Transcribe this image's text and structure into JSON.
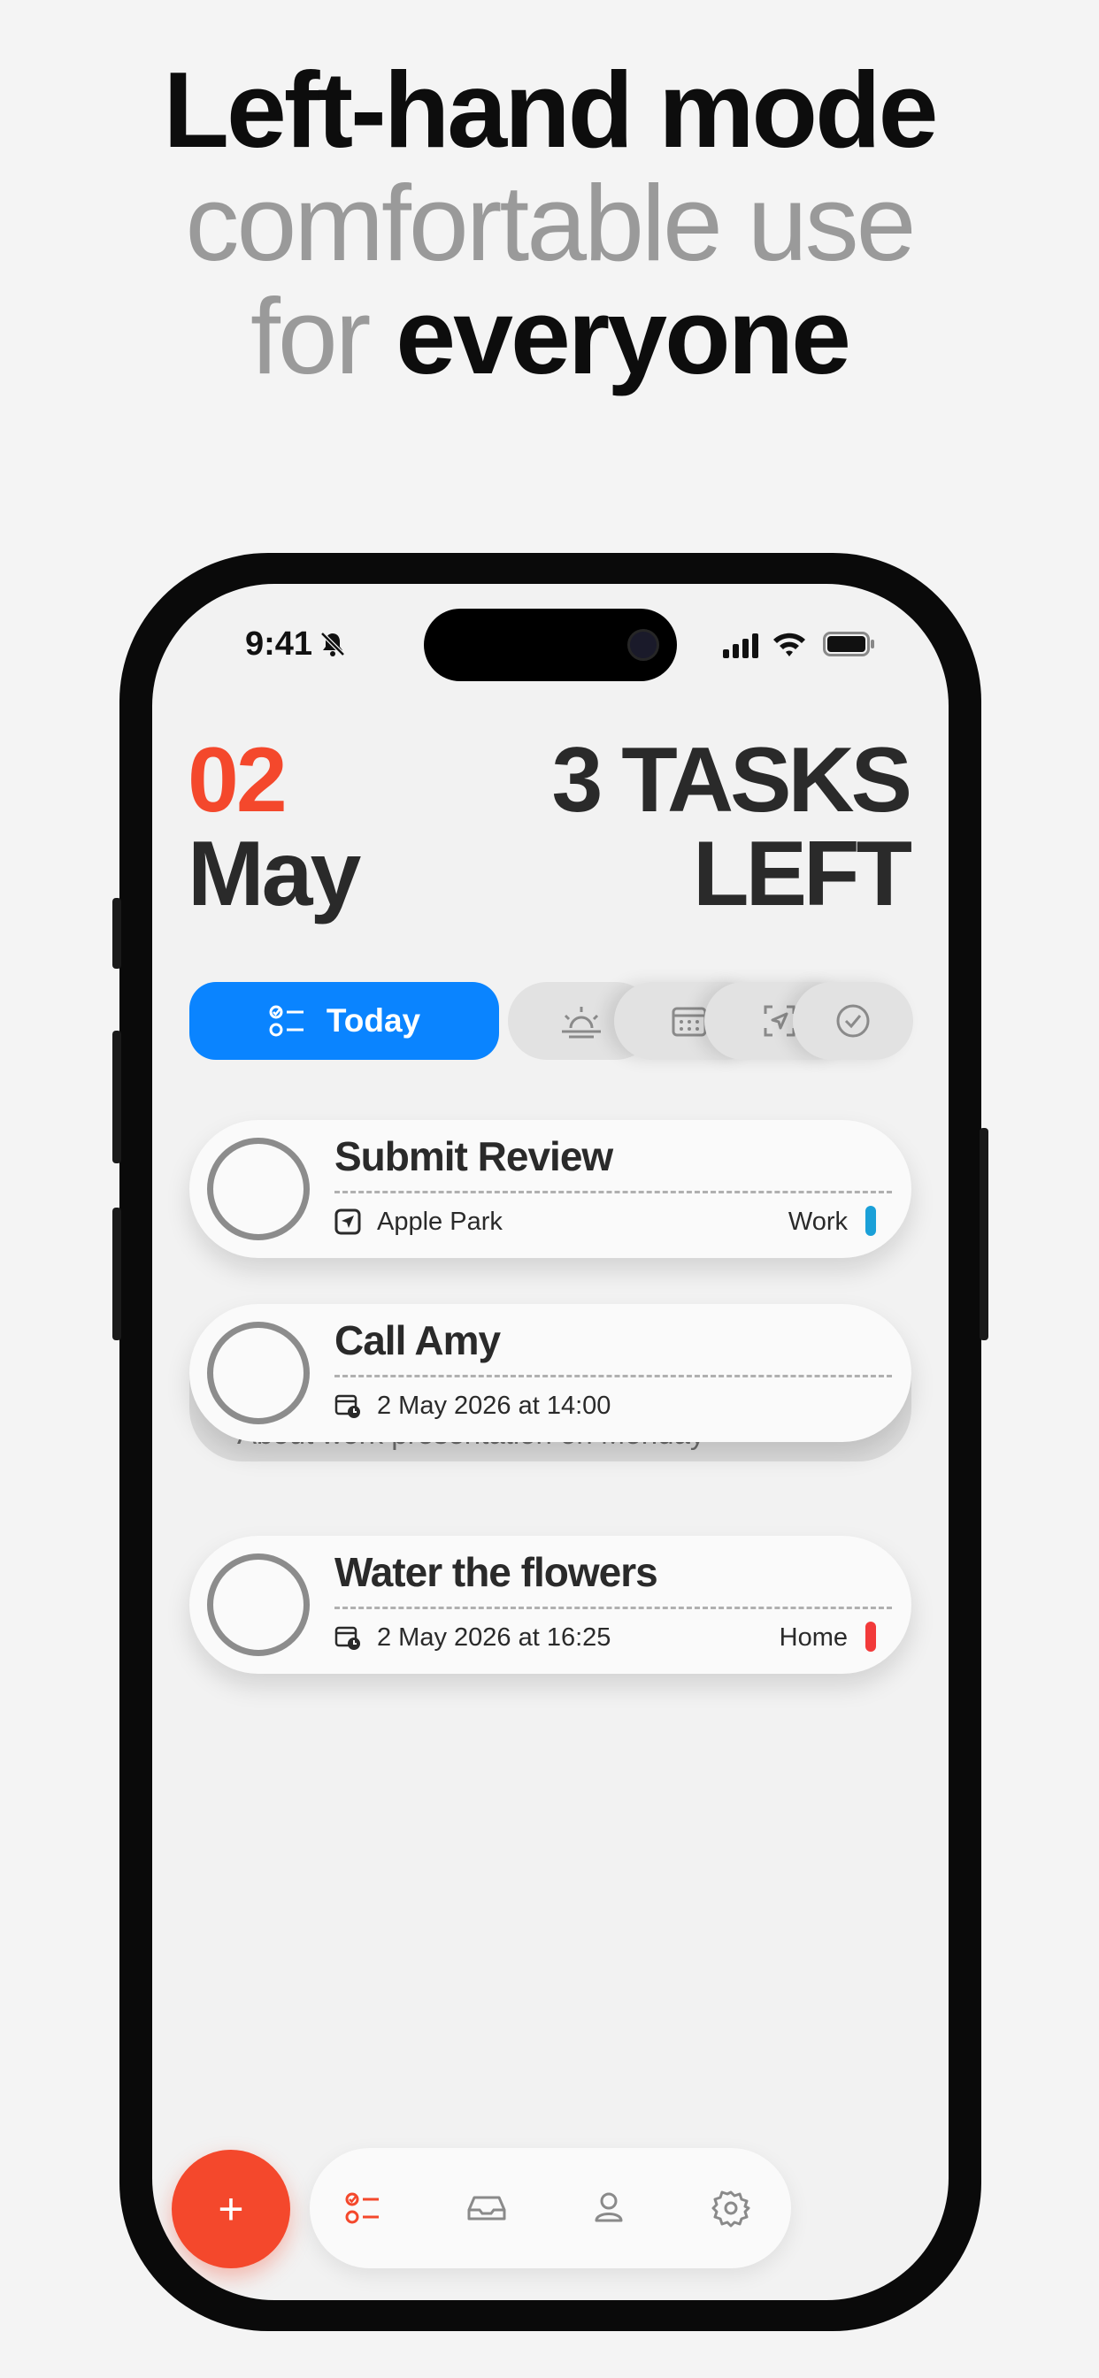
{
  "headline": {
    "line1": "Left-hand mode",
    "line2": "comfortable use",
    "line3_grey": "for",
    "line3_dark": "everyone"
  },
  "status_bar": {
    "time": "9:41"
  },
  "header": {
    "day": "02",
    "month": "May",
    "tasks_line1": "3 TASKS",
    "tasks_line2": "LEFT"
  },
  "filters": {
    "active_label": "Today",
    "icons": [
      "sunrise-icon",
      "calendar-icon",
      "location-icon",
      "check-circle-icon"
    ]
  },
  "tasks": [
    {
      "title": "Submit Review",
      "meta": "Apple Park",
      "meta_icon": "location-arrow-icon",
      "tag": "Work",
      "tag_color": "#1aa0d8"
    },
    {
      "title": "Call Amy",
      "meta": "2 May 2026 at 14:00",
      "meta_icon": "calendar-clock-icon",
      "note": "About work presentation on Monday"
    },
    {
      "title": "Water the flowers",
      "meta": "2 May 2026 at 16:25",
      "meta_icon": "calendar-clock-icon",
      "tag": "Home",
      "tag_color": "#f23a3a"
    }
  ],
  "tabbar": {
    "fab_label": "+",
    "tabs": [
      "tasks-icon",
      "inbox-icon",
      "profile-icon",
      "settings-icon"
    ]
  },
  "colors": {
    "accent": "#f4482c",
    "blue": "#0a84ff"
  }
}
